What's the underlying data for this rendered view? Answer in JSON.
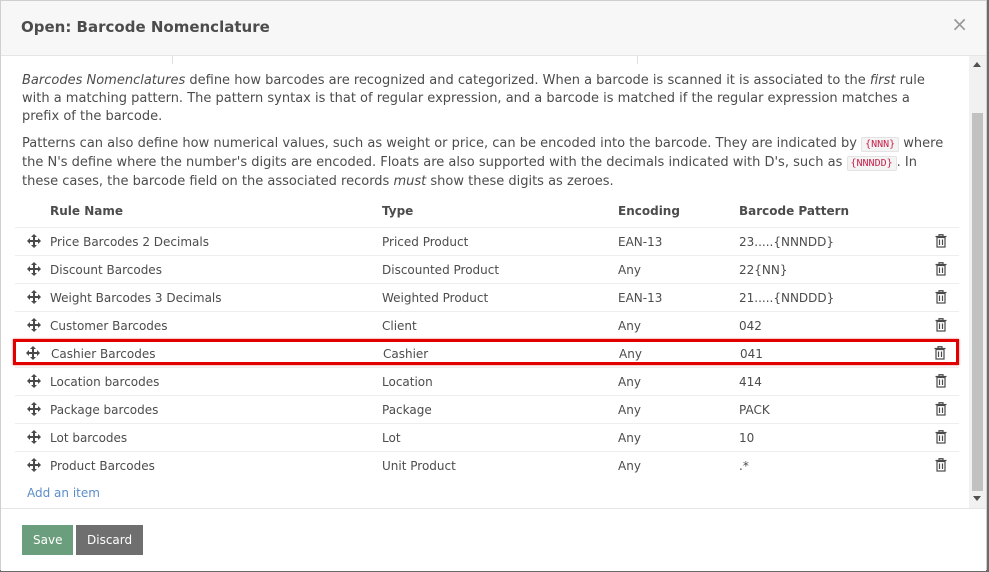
{
  "dialog": {
    "title": "Open: Barcode Nomenclature",
    "close_glyph": "×"
  },
  "description": {
    "p1": {
      "em1": "Barcodes Nomenclatures",
      "t1": " define how barcodes are recognized and categorized. When a barcode is scanned it is associated to the ",
      "em2": "first",
      "t2": " rule with a matching pattern. The pattern syntax is that of regular expression, and a barcode is matched if the regular expression matches a prefix of the barcode."
    },
    "p2": {
      "t1": "Patterns can also define how numerical values, such as weight or price, can be encoded into the barcode. They are indicated by ",
      "code1": "{NNN}",
      "t2": " where the N's define where the number's digits are encoded. Floats are also supported with the decimals indicated with D's, such as ",
      "code2": "{NNNDD}",
      "t3": ". In these cases, the barcode field on the associated records ",
      "em1": "must",
      "t4": " show these digits as zeroes."
    }
  },
  "table": {
    "headers": {
      "rule_name": "Rule Name",
      "type": "Type",
      "encoding": "Encoding",
      "pattern": "Barcode Pattern"
    },
    "rows": [
      {
        "name": "Price Barcodes 2 Decimals",
        "type": "Priced Product",
        "encoding": "EAN-13",
        "pattern": "23.....{NNNDD}"
      },
      {
        "name": "Discount Barcodes",
        "type": "Discounted Product",
        "encoding": "Any",
        "pattern": "22{NN}"
      },
      {
        "name": "Weight Barcodes 3 Decimals",
        "type": "Weighted Product",
        "encoding": "EAN-13",
        "pattern": "21.....{NNDDD}"
      },
      {
        "name": "Customer Barcodes",
        "type": "Client",
        "encoding": "Any",
        "pattern": "042"
      },
      {
        "name": "Cashier Barcodes",
        "type": "Cashier",
        "encoding": "Any",
        "pattern": "041"
      },
      {
        "name": "Location barcodes",
        "type": "Location",
        "encoding": "Any",
        "pattern": "414"
      },
      {
        "name": "Package barcodes",
        "type": "Package",
        "encoding": "Any",
        "pattern": "PACK"
      },
      {
        "name": "Lot barcodes",
        "type": "Lot",
        "encoding": "Any",
        "pattern": "10"
      },
      {
        "name": "Product Barcodes",
        "type": "Unit Product",
        "encoding": "Any",
        "pattern": ".*"
      }
    ],
    "selected_row_index": 4,
    "add_item_label": "Add an item"
  },
  "footer": {
    "save_label": "Save",
    "discard_label": "Discard"
  },
  "colors": {
    "highlight": "#e00000",
    "save": "#6b9e7c",
    "discard": "#6f6f6f",
    "link": "#5a8ec9"
  },
  "icons": {
    "row_handle": "drag-handle-icon",
    "row_delete": "trash-icon",
    "close": "close-icon"
  }
}
